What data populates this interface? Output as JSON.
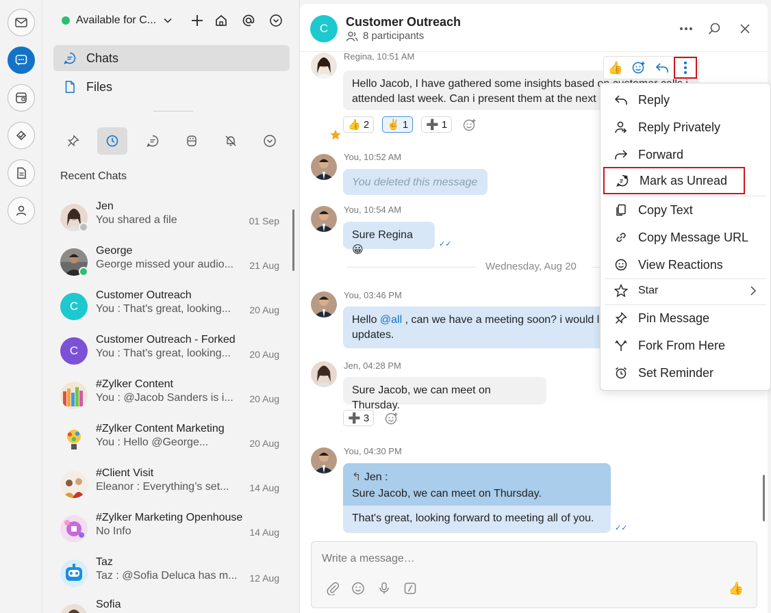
{
  "rail": {
    "items": [
      "mail",
      "chat",
      "channels",
      "tasks",
      "notes",
      "contacts"
    ]
  },
  "sidebar": {
    "status": "Available for C...",
    "nav": [
      {
        "label": "Chats"
      },
      {
        "label": "Files"
      }
    ],
    "section_title": "Recent Chats",
    "chats": [
      {
        "name": "Jen",
        "preview": "You shared a file",
        "date": "01 Sep",
        "initial": "",
        "presence": "#bdbdbd"
      },
      {
        "name": "George",
        "preview": "George missed your audio...",
        "date": "21 Aug",
        "initial": "",
        "presence": "#2dbd73"
      },
      {
        "name": "Customer Outreach",
        "preview": "You : That's great, looking...",
        "date": "20 Aug",
        "initial": "C",
        "color": "#1dc8cf"
      },
      {
        "name": "Customer Outreach - Forked",
        "preview": "You : That's great, looking...",
        "date": "20 Aug",
        "initial": "C",
        "color": "#7b52d6"
      },
      {
        "name": "#Zylker Content",
        "preview": "You : @Jacob Sanders  is i...",
        "date": "20 Aug",
        "initial": ""
      },
      {
        "name": "#Zylker Content Marketing",
        "preview": "You : Hello @George...",
        "date": "20 Aug",
        "initial": ""
      },
      {
        "name": "#Client Visit",
        "preview": "Eleanor : Everything’s set...",
        "date": "14 Aug",
        "initial": ""
      },
      {
        "name": "#Zylker Marketing Openhouse",
        "preview": "No Info",
        "date": "14 Aug",
        "initial": ""
      },
      {
        "name": "Taz",
        "preview": "Taz : @Sofia Deluca has m...",
        "date": "12 Aug",
        "initial": ""
      },
      {
        "name": "Sofia",
        "preview": "",
        "date": "",
        "initial": ""
      }
    ]
  },
  "conversation": {
    "title": "Customer Outreach",
    "participants": "8 participants",
    "initial": "C",
    "messages": {
      "m1": {
        "meta": "Regina, 10:51 AM",
        "text": "Hello Jacob, I have gathered some insights based on customer calls i attended last week. Can i present them at the next meeting?"
      },
      "m1_line1": "Hello Jacob, I have gathered some insights based on customer calls i",
      "m1_line2": "attended last week. Can i present them at the next",
      "m1_reactions": [
        {
          "emoji": "👍",
          "count": "2"
        },
        {
          "emoji": "✌️",
          "count": "1"
        },
        {
          "emoji": "➕",
          "count": "1"
        }
      ],
      "m2": {
        "meta": "You, 10:52 AM",
        "text": "You deleted this message"
      },
      "m3": {
        "meta": "You, 10:54 AM",
        "text": "Sure Regina 😀"
      },
      "date_sep": "Wednesday, Aug 20",
      "m4": {
        "meta": "You, 03:46 PM",
        "pre": "Hello ",
        "mention": "@all",
        "post": " , can we have a meeting soon? i would l",
        "line2": "updates."
      },
      "m5": {
        "meta": "Jen, 04:28 PM",
        "text": "Sure Jacob, we can meet on Thursday."
      },
      "m5_reaction": {
        "emoji": "➕",
        "count": "3"
      },
      "m6": {
        "meta": "You, 04:30 PM",
        "quote_author": "Jen :",
        "quote_text": "Sure Jacob, we can meet on Thursday.",
        "text": "That's great, looking forward to meeting all of you."
      }
    }
  },
  "composer": {
    "placeholder": "Write a message…"
  },
  "context_menu": {
    "items": [
      {
        "label": "Reply",
        "icon": "reply-icon"
      },
      {
        "label": "Reply Privately",
        "icon": "person-reply-icon"
      },
      {
        "label": "Forward",
        "icon": "forward-icon"
      },
      {
        "label": "Mark as Unread",
        "icon": "unread-icon"
      },
      {
        "label": "Copy Text",
        "icon": "copy-icon"
      },
      {
        "label": "Copy Message URL",
        "icon": "link-icon"
      },
      {
        "label": "View Reactions",
        "icon": "smiley-icon"
      },
      {
        "label": "Star",
        "icon": "star-icon"
      },
      {
        "label": "Pin Message",
        "icon": "pin-icon"
      },
      {
        "label": "Fork From Here",
        "icon": "fork-icon"
      },
      {
        "label": "Set Reminder",
        "icon": "alarm-icon"
      }
    ]
  },
  "colors": {
    "accent": "#1273c8",
    "highlight_border": "#d0141d",
    "mine_bubble": "#d7e7f7"
  }
}
